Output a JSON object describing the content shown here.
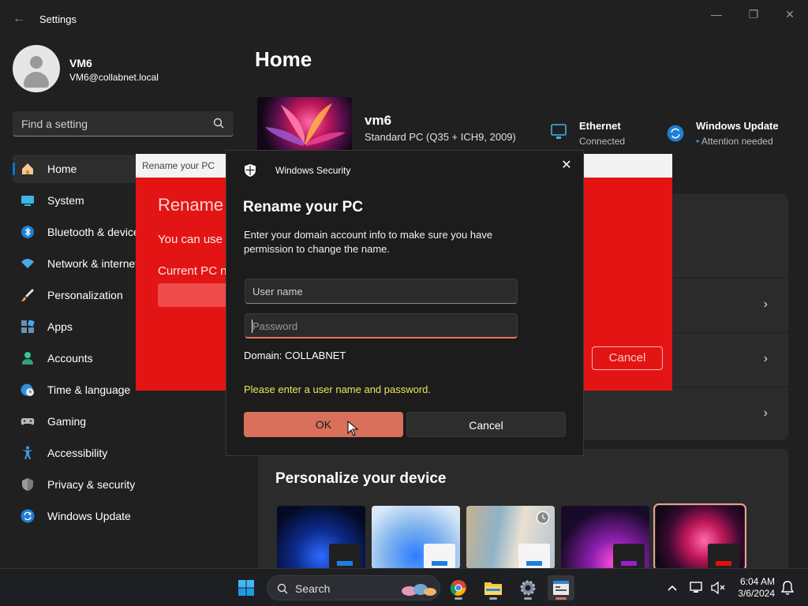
{
  "window": {
    "title": "Settings",
    "back_glyph": "←",
    "minimize_glyph": "—",
    "restore_glyph": "❐",
    "close_glyph": "✕"
  },
  "profile": {
    "name": "VM6",
    "email": "VM6@collabnet.local"
  },
  "search": {
    "placeholder": "Find a setting"
  },
  "sidebar": {
    "items": [
      {
        "label": "Home",
        "icon": "home-icon",
        "active": true
      },
      {
        "label": "System",
        "icon": "system-icon"
      },
      {
        "label": "Bluetooth & devices",
        "icon": "bluetooth-icon"
      },
      {
        "label": "Network & internet",
        "icon": "network-icon"
      },
      {
        "label": "Personalization",
        "icon": "brush-icon"
      },
      {
        "label": "Apps",
        "icon": "apps-icon"
      },
      {
        "label": "Accounts",
        "icon": "accounts-icon"
      },
      {
        "label": "Time & language",
        "icon": "clock-globe-icon"
      },
      {
        "label": "Gaming",
        "icon": "gamepad-icon"
      },
      {
        "label": "Accessibility",
        "icon": "accessibility-icon"
      },
      {
        "label": "Privacy & security",
        "icon": "shield-icon"
      },
      {
        "label": "Windows Update",
        "icon": "update-icon"
      }
    ]
  },
  "main": {
    "title": "Home",
    "device_name": "vm6",
    "device_model": "Standard PC (Q35 + ICH9, 2009)",
    "ethernet": {
      "title": "Ethernet",
      "status": "Connected"
    },
    "windows_update": {
      "title": "Windows Update",
      "status": "Attention needed",
      "status_prefix": "•"
    },
    "chevron": "›",
    "personalize_title": "Personalize your device"
  },
  "rename_background": {
    "header": "Rename your PC",
    "title": "Rename",
    "text": "You can use a",
    "label": "Current PC n",
    "cancel": "Cancel"
  },
  "security_dialog": {
    "header": "Windows Security",
    "close_glyph": "✕",
    "title": "Rename your PC",
    "description": "Enter your domain account info to make sure you have permission to change the name.",
    "username_placeholder": "User name",
    "password_placeholder": "Password",
    "domain": "Domain: COLLABNET",
    "warning": "Please enter a user name and password.",
    "ok": "OK",
    "cancel": "Cancel"
  },
  "taskbar": {
    "search_label": "Search",
    "time": "6:04 AM",
    "date": "3/6/2024"
  },
  "colors": {
    "accent": "#0078d4",
    "ok_button": "#d9705b",
    "warning_text": "#e8e85a",
    "rename_red": "#e31414"
  }
}
